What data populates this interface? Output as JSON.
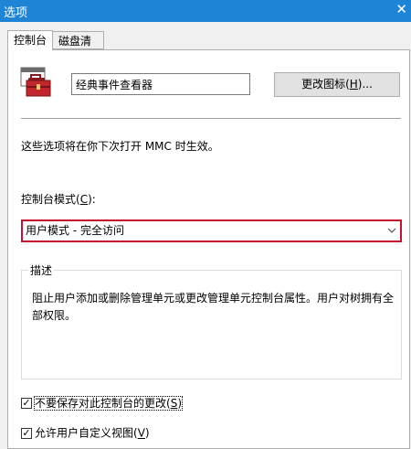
{
  "window": {
    "title": "选项",
    "close_glyph": "✕"
  },
  "tabs": [
    {
      "label": "控制台",
      "active": true
    },
    {
      "label": "磁盘清理",
      "active": false
    }
  ],
  "console": {
    "name_value": "经典事件查看器",
    "change_icon_label": "更改图标",
    "change_icon_accel": "H",
    "change_icon_suffix": ")...",
    "info_text": "这些选项将在你下次打开 MMC 时生效。",
    "mode_label_prefix": "控制台模式(",
    "mode_label_accel": "C",
    "mode_label_suffix": "):",
    "mode_selected": "用户模式 - 完全访问",
    "description_title": "描述",
    "description_text": "阻止用户添加或删除管理单元或更改管理单元控制台属性。用户对树拥有全部权限。",
    "checkbox_no_save": {
      "prefix": "不要保存对此控制台的更改(",
      "accel": "S",
      "suffix": ")",
      "checked": true
    },
    "checkbox_custom_view": {
      "prefix": "允许用户自定义视图(",
      "accel": "V",
      "suffix": ")",
      "checked": true
    }
  },
  "icons": {
    "app": "toolbox-icon",
    "dropdown": "chevron-down-icon",
    "check": "check-icon",
    "close": "close-icon"
  },
  "colors": {
    "titlebar": "#1e84d6",
    "combo_border": "#c4122f",
    "toolbox_red": "#c0262c"
  }
}
